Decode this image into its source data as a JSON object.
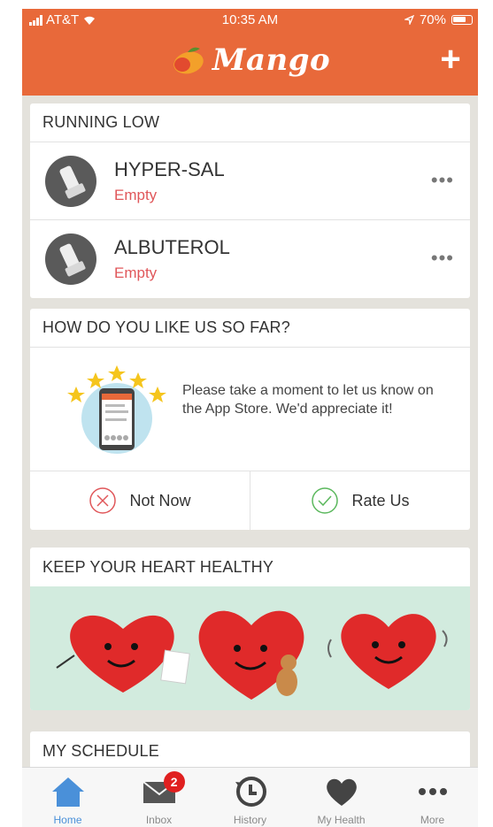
{
  "status_bar": {
    "carrier": "AT&T",
    "time": "10:35 AM",
    "battery": "70%"
  },
  "header": {
    "title": "Mango",
    "add_label": "+"
  },
  "running_low": {
    "title": "RUNNING LOW",
    "items": [
      {
        "name": "HYPER-SAL",
        "status": "Empty"
      },
      {
        "name": "ALBUTEROL",
        "status": "Empty"
      }
    ]
  },
  "rating": {
    "title": "HOW DO YOU LIKE US SO FAR?",
    "message": "Please take a moment to let us know on the App Store. We'd appreciate it!",
    "not_now_label": "Not Now",
    "rate_label": "Rate Us"
  },
  "heart": {
    "title": "KEEP YOUR HEART HEALTHY"
  },
  "schedule": {
    "title": "MY SCHEDULE"
  },
  "tabs": [
    {
      "label": "Home",
      "icon": "home-icon",
      "active": true
    },
    {
      "label": "Inbox",
      "icon": "mail-icon",
      "badge": "2"
    },
    {
      "label": "History",
      "icon": "history-icon"
    },
    {
      "label": "My Health",
      "icon": "heart-icon"
    },
    {
      "label": "More",
      "icon": "more-icon"
    }
  ],
  "colors": {
    "brand": "#e8693a",
    "empty_status": "#e0575a",
    "active_tab": "#4a90d9",
    "banner": "#d2ebde"
  }
}
